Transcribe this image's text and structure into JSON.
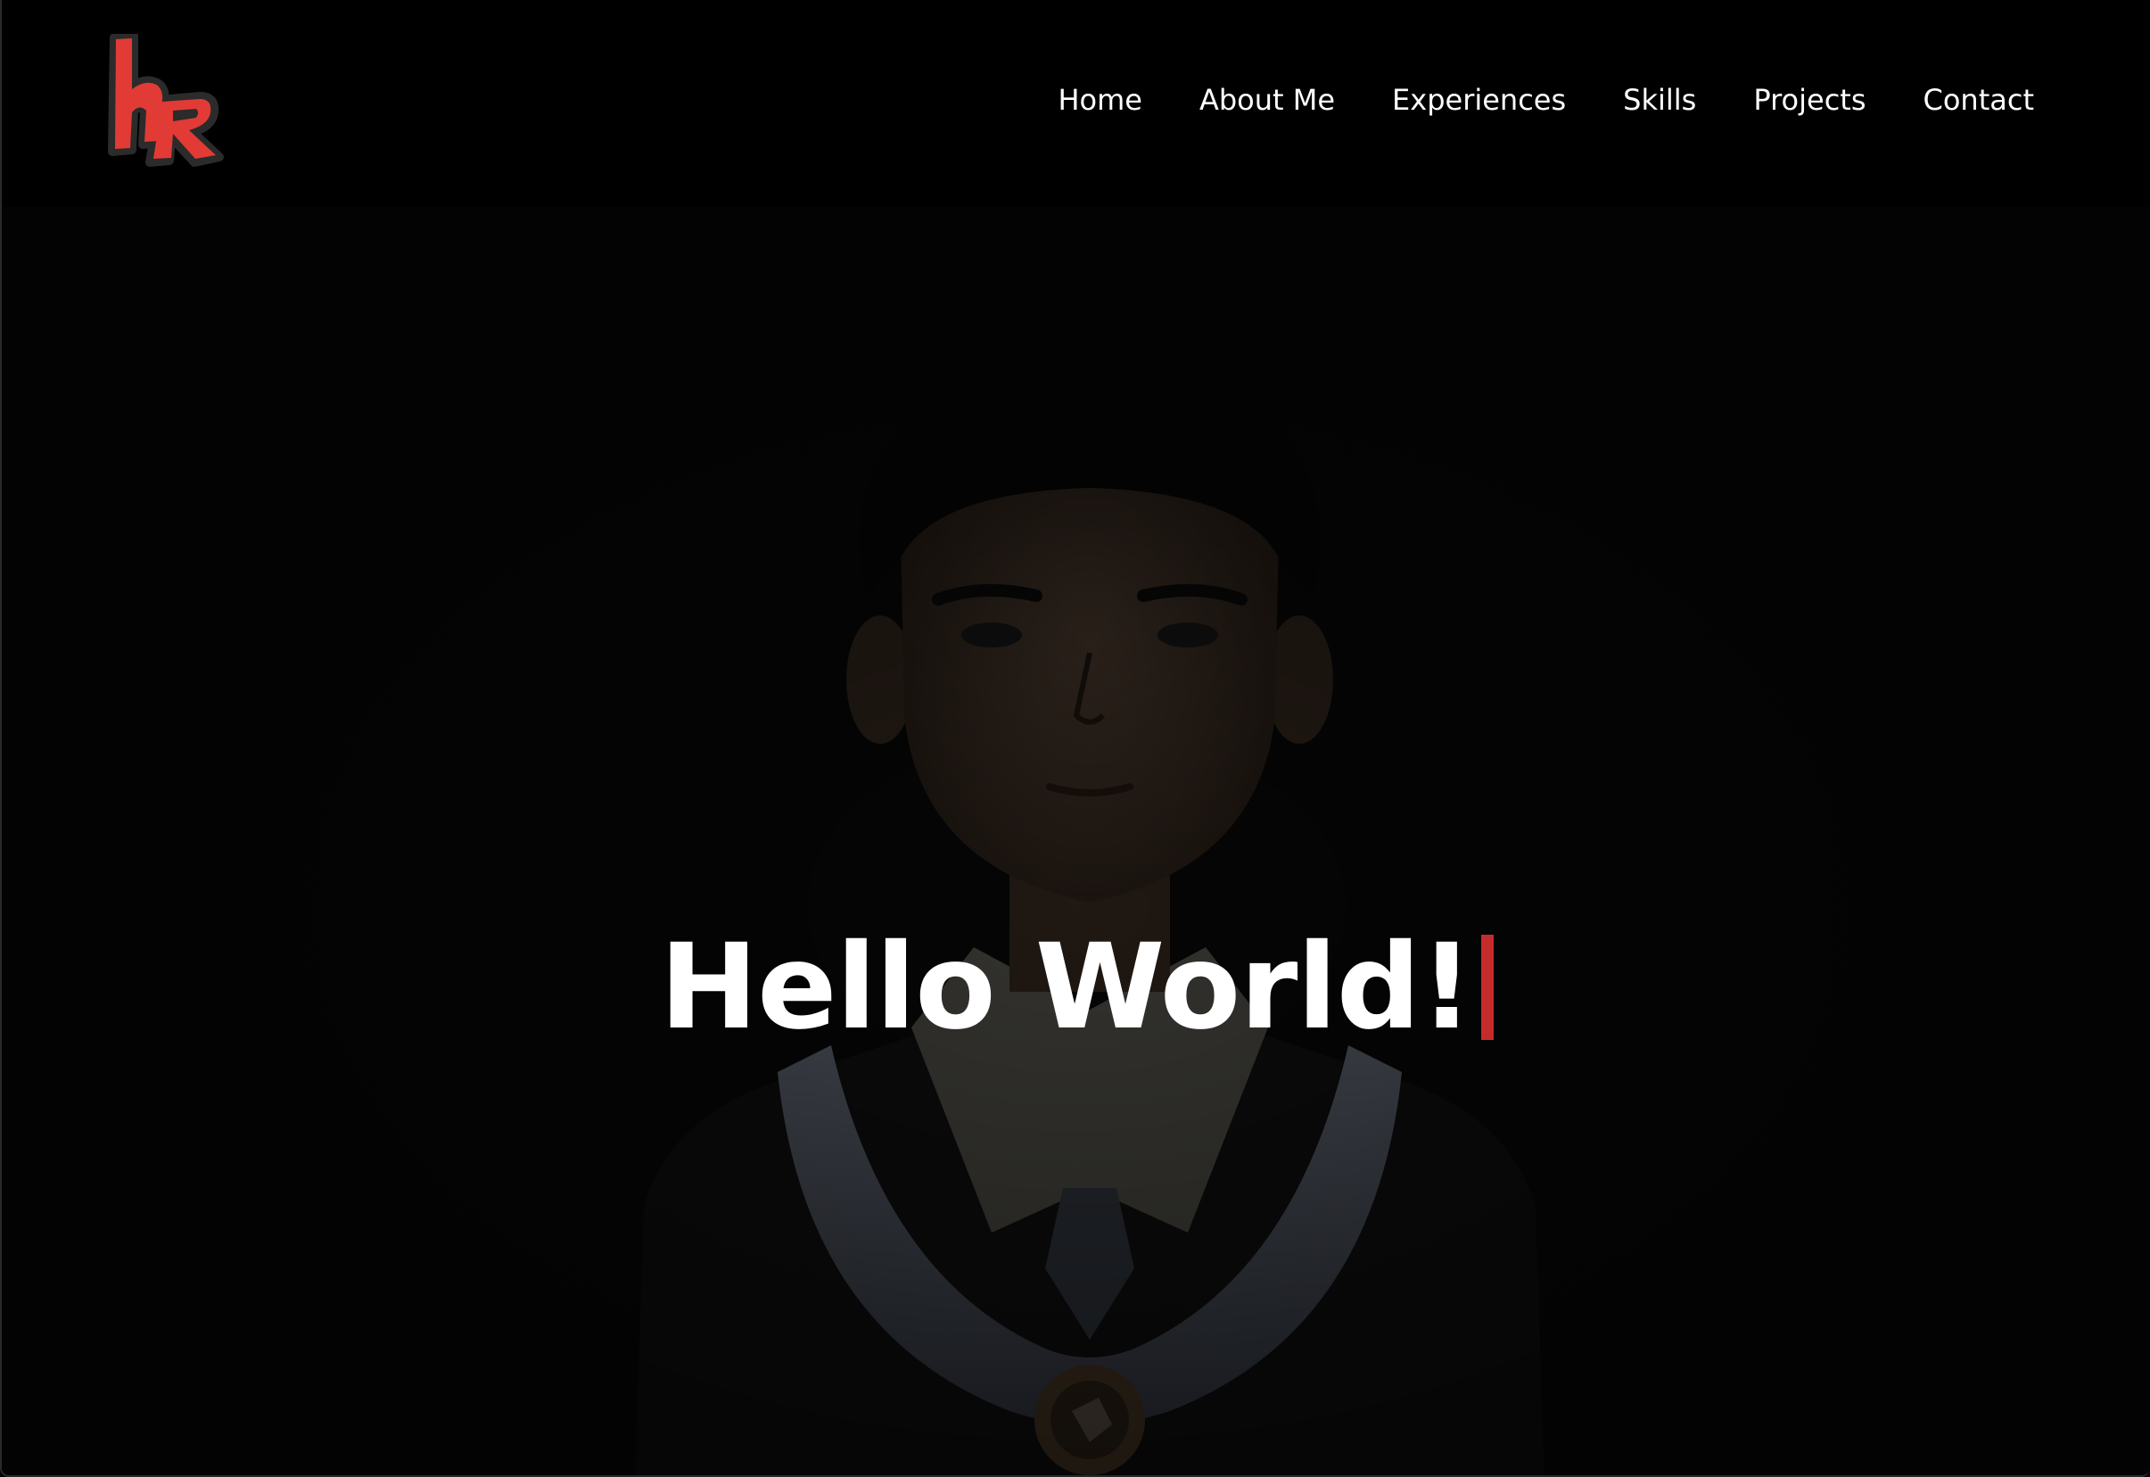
{
  "brand": {
    "logo_icon": "hr-monogram-logo",
    "accent_color": "#e23b35"
  },
  "nav": {
    "items": [
      {
        "label": "Home"
      },
      {
        "label": "About Me"
      },
      {
        "label": "Experiences"
      },
      {
        "label": "Skills"
      },
      {
        "label": "Projects"
      },
      {
        "label": "Contact"
      }
    ]
  },
  "hero": {
    "title": "Hello World!",
    "cursor_color": "#c62b2b",
    "background_image": "graduation-portrait"
  }
}
